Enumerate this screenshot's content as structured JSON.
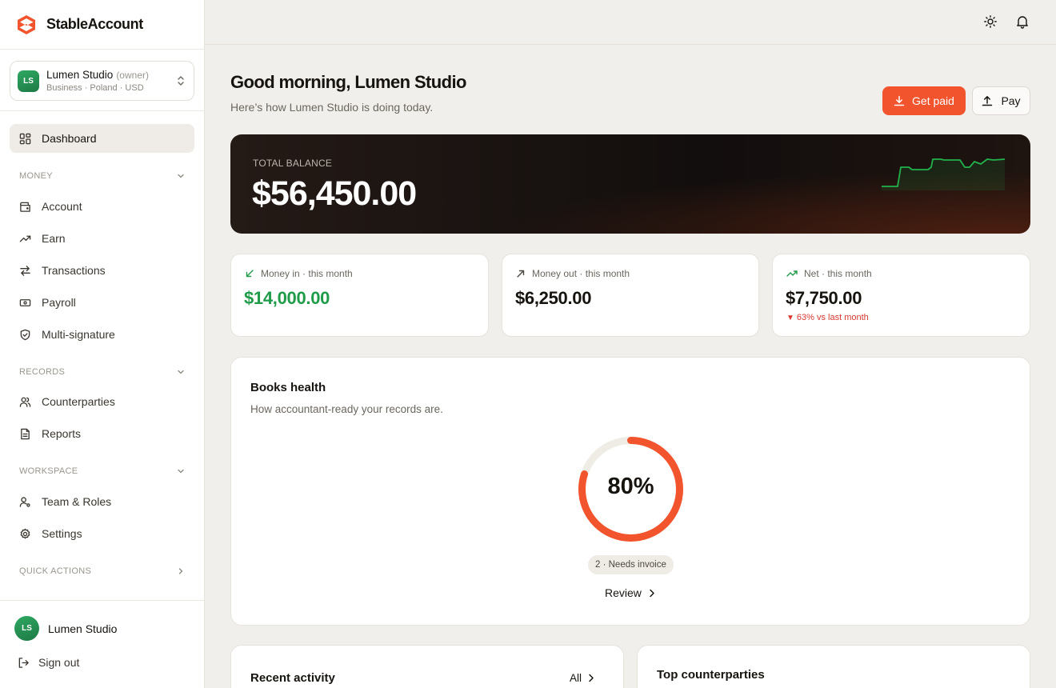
{
  "brand": {
    "name": "StableAccount",
    "accent": "#f2542d"
  },
  "account": {
    "initials": "LS",
    "name": "Lumen Studio",
    "role": "(owner)",
    "meta": "Business · Poland · USD"
  },
  "nav": {
    "dashboard": "Dashboard",
    "money_section": "MONEY",
    "account": "Account",
    "earn": "Earn",
    "transactions": "Transactions",
    "payroll": "Payroll",
    "multisig": "Multi-signature",
    "records_section": "RECORDS",
    "counterparties": "Counterparties",
    "reports": "Reports",
    "workspace_section": "WORKSPACE",
    "team": "Team & Roles",
    "settings": "Settings",
    "quick_section": "QUICK ACTIONS"
  },
  "user": {
    "initials": "LS",
    "name": "Lumen Studio",
    "signout": "Sign out"
  },
  "header": {
    "greeting": "Good morning, Lumen Studio",
    "subtitle": "Here’s how Lumen Studio is doing today.",
    "get_paid": "Get paid",
    "pay": "Pay"
  },
  "balance": {
    "label": "TOTAL BALANCE",
    "value": "$56,450.00",
    "sparkline_color": "#22b24c"
  },
  "stats": {
    "money_in": {
      "label": "Money in · this month",
      "value": "$14,000.00",
      "color": "#1f9b49"
    },
    "money_out": {
      "label": "Money out · this month",
      "value": "$6,250.00"
    },
    "net": {
      "label": "Net · this month",
      "value": "$7,750.00",
      "trend": "63% vs last month",
      "trend_color": "#d93a31"
    }
  },
  "books_health": {
    "title": "Books health",
    "subtitle": "How accountant-ready your records are.",
    "percent_label": "80%",
    "percent": 80,
    "pill": "2 · Needs invoice",
    "review": "Review"
  },
  "recent_activity": {
    "title": "Recent activity",
    "all": "All"
  },
  "top_counterparties": {
    "title": "Top counterparties"
  }
}
